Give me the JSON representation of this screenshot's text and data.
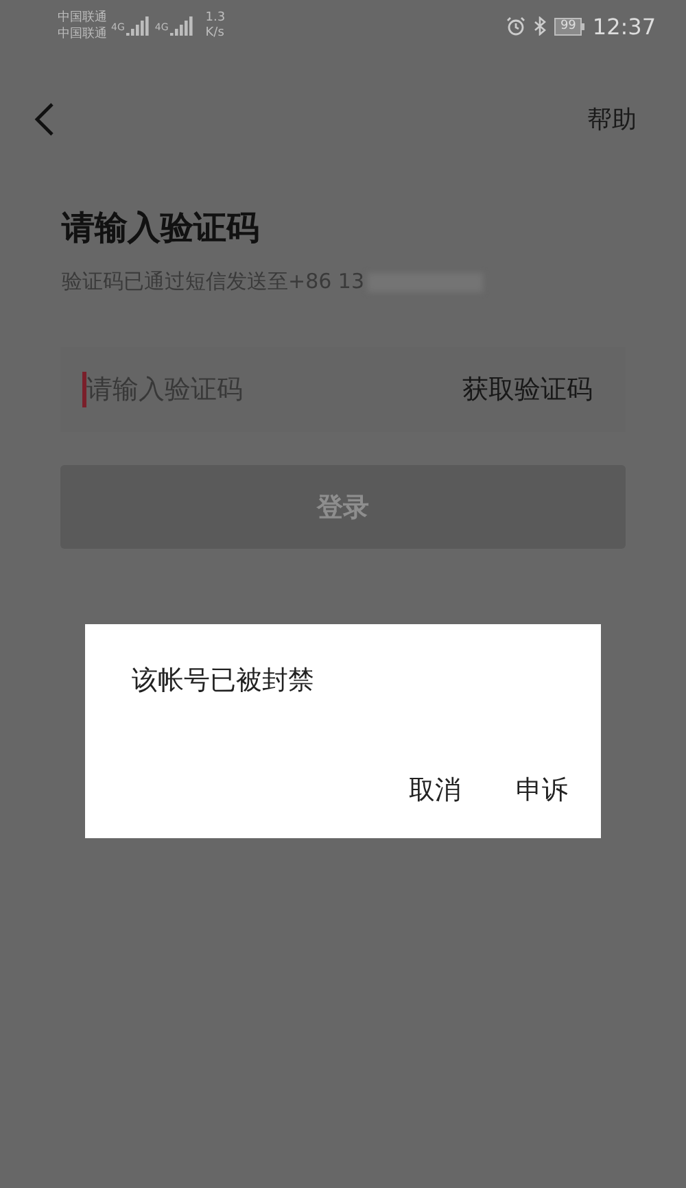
{
  "status_bar": {
    "carriers": [
      "中国联通",
      "中国联通"
    ],
    "networks": [
      "4G",
      "4G"
    ],
    "speed": [
      "1.3",
      "K/s"
    ],
    "battery": "99",
    "time": "12:37"
  },
  "nav": {
    "help": "帮助"
  },
  "title": "请输入验证码",
  "subtitle": "验证码已通过短信发送至+86 13",
  "code_field": {
    "placeholder": "请输入验证码",
    "get_code": "获取验证码"
  },
  "login_button": {
    "label": "登录",
    "disabled": true
  },
  "dialog": {
    "message": "该帐号已被封禁",
    "buttons": [
      "取消",
      "申诉"
    ]
  }
}
